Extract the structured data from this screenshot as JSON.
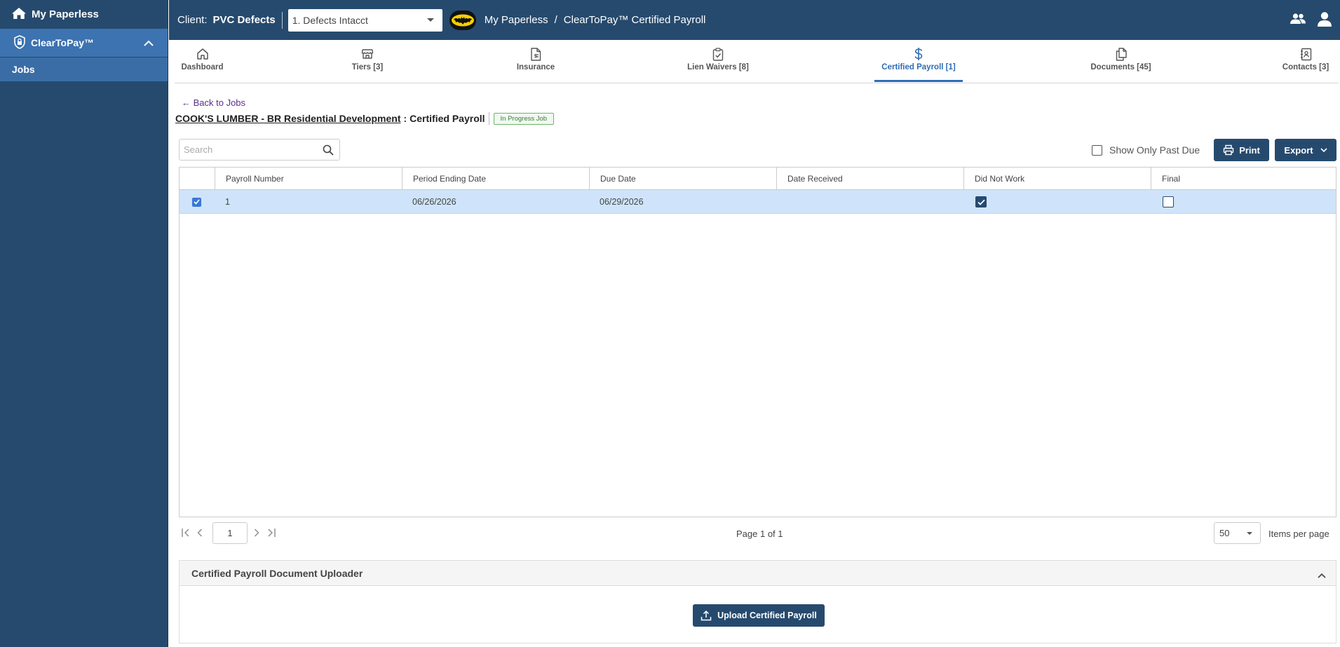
{
  "sidebar": {
    "home_label": "My Paperless",
    "section_label": "ClearToPay™",
    "items": [
      {
        "label": "Jobs"
      }
    ]
  },
  "header": {
    "client_label": "Client:",
    "client_name": "PVC Defects",
    "client_select": "1. Defects Intacct",
    "breadcrumb": [
      "My Paperless",
      "/",
      "ClearToPay™ Certified Payroll"
    ]
  },
  "tabs": [
    {
      "label": "Dashboard",
      "icon": "home-icon"
    },
    {
      "label": "Tiers [3]",
      "icon": "store-icon"
    },
    {
      "label": "Insurance",
      "icon": "invoice-icon"
    },
    {
      "label": "Lien Waivers [8]",
      "icon": "clipboard-check-icon"
    },
    {
      "label": "Certified Payroll [1]",
      "icon": "dollar-icon",
      "active": true
    },
    {
      "label": "Documents [45]",
      "icon": "documents-icon"
    },
    {
      "label": "Contacts [3]",
      "icon": "contacts-icon"
    }
  ],
  "page": {
    "back_label": "← Back to Jobs",
    "job_name": "COOK'S LUMBER - BR Residential Development",
    "colon": ":",
    "page_title": "Certified Payroll",
    "status_badge": "In Progress Job",
    "search_placeholder": "Search",
    "past_due_label": "Show Only Past Due",
    "print_label": "Print",
    "export_label": "Export"
  },
  "table": {
    "columns": [
      "Payroll Number",
      "Period Ending Date",
      "Due Date",
      "Date Received",
      "Did Not Work",
      "Final"
    ],
    "rows": [
      {
        "selected": true,
        "payroll_number": "1",
        "period_ending": "06/26/2026",
        "due_date": "06/29/2026",
        "date_received": "",
        "did_not_work": true,
        "final": false
      }
    ]
  },
  "pager": {
    "page_input": "1",
    "page_info": "Page 1 of 1",
    "page_size": "50",
    "items_label": "Items per page"
  },
  "uploader": {
    "title": "Certified Payroll Document Uploader",
    "button_label": "Upload Certified Payroll"
  },
  "colors": {
    "navy": "#264a6e",
    "accent_blue": "#2f6db5",
    "row_selected": "#cfe4fa",
    "link_purple": "#5a2d91"
  }
}
